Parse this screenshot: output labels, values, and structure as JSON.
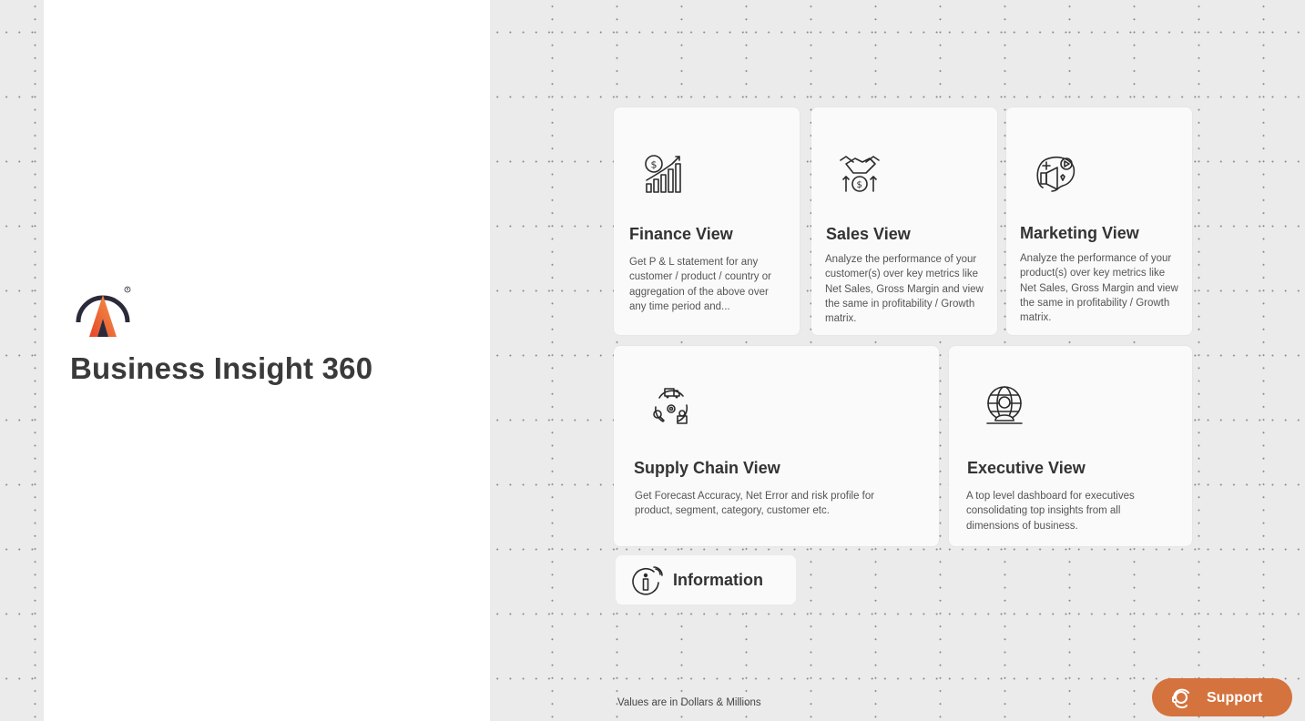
{
  "app": {
    "title": "Business Insight 360"
  },
  "cards": [
    {
      "title": "Finance View",
      "description": "Get P & L statement for any customer / product / country or aggregation of the above over any time period and...",
      "icon": "finance-chart-icon"
    },
    {
      "title": "Sales View",
      "description": "Analyze the performance of your customer(s) over key metrics like Net Sales, Gross Margin and view the same in profitability / Growth matrix.",
      "icon": "handshake-dollar-icon"
    },
    {
      "title": "Marketing View",
      "description": "Analyze the performance of your product(s) over key metrics like Net Sales, Gross Margin and view the same in profitability / Growth matrix.",
      "icon": "marketing-megaphone-icon"
    },
    {
      "title": "Supply Chain View",
      "description": "Get Forecast Accuracy, Net Error and risk profile for product, segment, category, customer etc.",
      "icon": "supply-chain-icon"
    },
    {
      "title": "Executive View",
      "description": "A top level dashboard for executives consolidating top insights from all dimensions of business.",
      "icon": "executive-globe-icon"
    }
  ],
  "information": {
    "label": "Information",
    "icon": "info-icon"
  },
  "footnote": "Values are in Dollars & Millions",
  "support": {
    "label": "Support",
    "icon": "headset-icon"
  },
  "colors": {
    "accent": "#d4733e",
    "logo_orange": "#e85a2a",
    "logo_dark": "#2a2a3a",
    "card_bg": "#fafafa",
    "background": "#ebebeb"
  }
}
